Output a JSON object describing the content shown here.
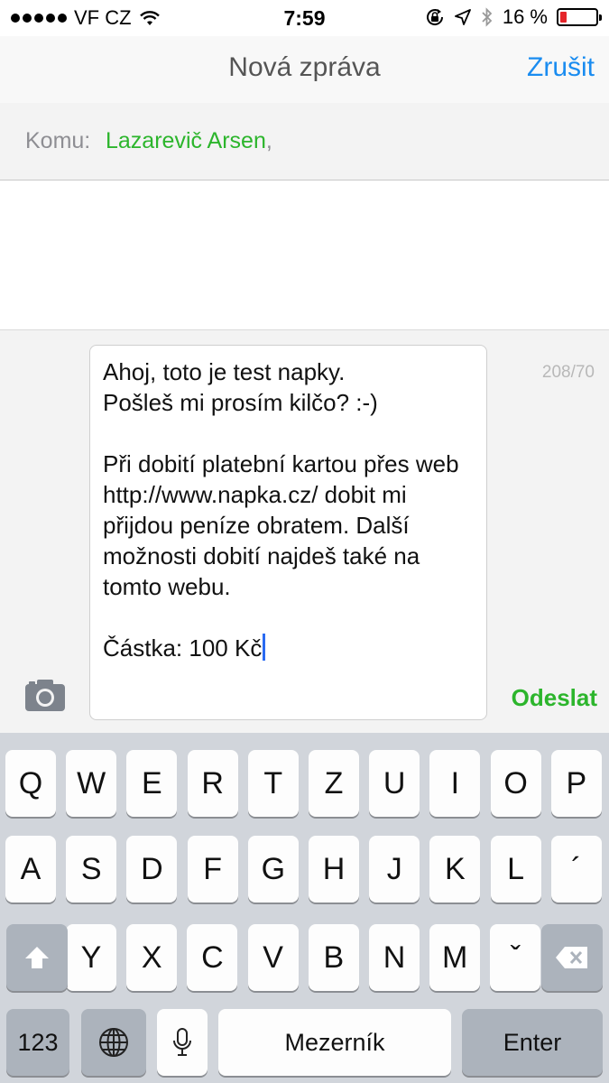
{
  "status_bar": {
    "carrier": "VF CZ",
    "time": "7:59",
    "battery": "16 %",
    "battery_level": 0.16,
    "icons": [
      "signal-dots-icon",
      "wifi-icon",
      "rotation-lock-icon",
      "location-arrow-icon",
      "bluetooth-icon",
      "battery-icon"
    ]
  },
  "nav": {
    "title": "Nová zpráva",
    "cancel": "Zrušit"
  },
  "recipient": {
    "label": "Komu:",
    "name": "Lazarevič Arsen",
    "separator": ","
  },
  "composer": {
    "text": "Ahoj, toto je test napky.\nPošleš mi prosím kilčo? :-)\n\nPři dobití platební kartou přes web http://www.napka.cz/ dobit mi přijdou peníze obratem. Další možnosti dobití najdeš také na tomto webu.\n\nČástka: 100 Kč",
    "char_count": "208/70",
    "send": "Odeslat",
    "camera_icon": "camera-icon"
  },
  "keyboard": {
    "row1": [
      "Q",
      "W",
      "E",
      "R",
      "T",
      "Z",
      "U",
      "I",
      "O",
      "P"
    ],
    "row2": [
      "A",
      "S",
      "D",
      "F",
      "G",
      "H",
      "J",
      "K",
      "L",
      "´"
    ],
    "row3": [
      "Y",
      "X",
      "C",
      "V",
      "B",
      "N",
      "M",
      "ˇ"
    ],
    "numbers": "123",
    "space": "Mezerník",
    "enter": "Enter",
    "shift_icon": "shift-icon",
    "globe_icon": "globe-icon",
    "mic_icon": "microphone-icon",
    "backspace_icon": "backspace-icon"
  },
  "colors": {
    "accent_blue": "#1a8cf0",
    "accent_green": "#2cb52c",
    "battery_low": "#e5262b",
    "keyboard_bg": "#d1d5db"
  }
}
